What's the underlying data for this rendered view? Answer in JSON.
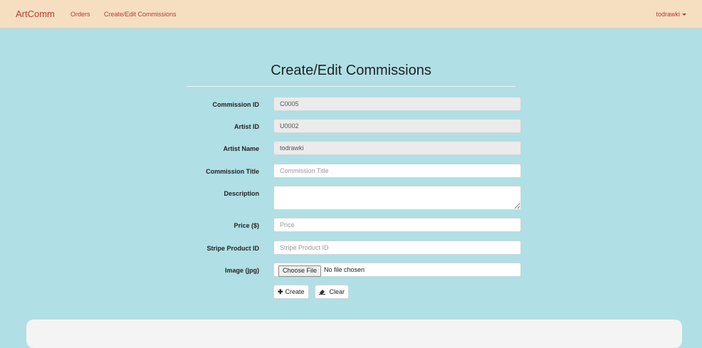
{
  "navbar": {
    "brand": "ArtComm",
    "links": [
      {
        "label": "Orders"
      },
      {
        "label": "Create/Edit Commissions"
      }
    ],
    "user": "todrawki"
  },
  "page": {
    "title": "Create/Edit Commissions"
  },
  "form": {
    "commission_id": {
      "label": "Commission ID",
      "value": "C0005"
    },
    "artist_id": {
      "label": "Artist ID",
      "value": "U0002"
    },
    "artist_name": {
      "label": "Artist Name",
      "value": "todrawki"
    },
    "commission_title": {
      "label": "Commission Title",
      "placeholder": "Commission Title"
    },
    "description": {
      "label": "Description"
    },
    "price": {
      "label": "Price ($)",
      "placeholder": "Price"
    },
    "stripe_product_id": {
      "label": "Stripe Product ID",
      "placeholder": "Stripe Product ID"
    },
    "image": {
      "label": "Image (jpg)",
      "button": "Choose File",
      "status": "No file chosen"
    }
  },
  "buttons": {
    "create": "Create",
    "clear": "Clear"
  },
  "icons": {
    "create": "plus-icon",
    "clear": "eraser-icon"
  }
}
